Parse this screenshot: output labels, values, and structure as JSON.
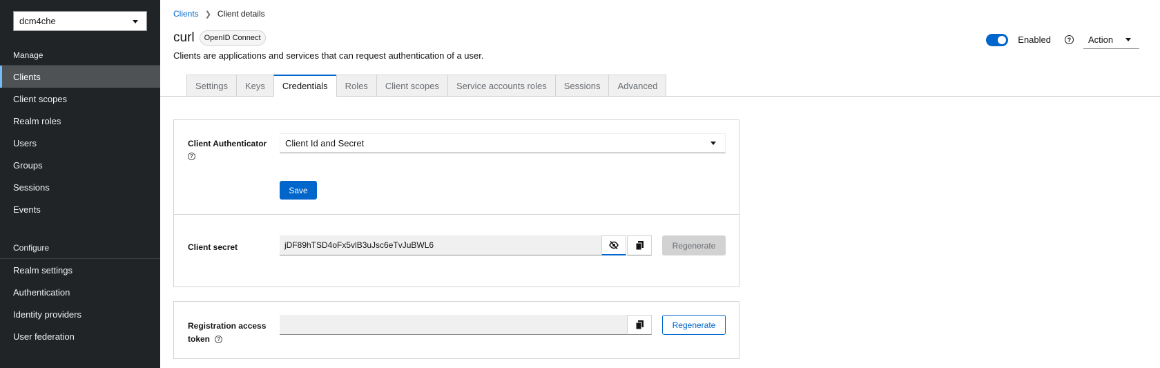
{
  "sidebar": {
    "realm_selector": "dcm4che",
    "manage_title": "Manage",
    "manage_items": [
      {
        "label": "Clients",
        "active": true
      },
      {
        "label": "Client scopes"
      },
      {
        "label": "Realm roles"
      },
      {
        "label": "Users"
      },
      {
        "label": "Groups"
      },
      {
        "label": "Sessions"
      },
      {
        "label": "Events"
      }
    ],
    "configure_title": "Configure",
    "configure_items": [
      {
        "label": "Realm settings"
      },
      {
        "label": "Authentication"
      },
      {
        "label": "Identity providers"
      },
      {
        "label": "User federation"
      }
    ]
  },
  "breadcrumb": {
    "parent": "Clients",
    "current": "Client details"
  },
  "header": {
    "title": "curl",
    "protocol_badge": "OpenID Connect",
    "description": "Clients are applications and services that can request authentication of a user.",
    "enabled_label": "Enabled",
    "enabled": true,
    "action_label": "Action"
  },
  "tabs": [
    {
      "label": "Settings"
    },
    {
      "label": "Keys"
    },
    {
      "label": "Credentials",
      "active": true
    },
    {
      "label": "Roles"
    },
    {
      "label": "Client scopes"
    },
    {
      "label": "Service accounts roles"
    },
    {
      "label": "Sessions"
    },
    {
      "label": "Advanced"
    }
  ],
  "credentials": {
    "authenticator_label": "Client Authenticator",
    "authenticator_value": "Client Id and Secret",
    "save_label": "Save",
    "secret_label": "Client secret",
    "secret_value": "jDF89hTSD4oFx5vlB3uJsc6eTvJuBWL6",
    "regenerate_label": "Regenerate",
    "registration_label_line1": "Registration access",
    "registration_label_line2": "token",
    "registration_value": "",
    "registration_regenerate_label": "Regenerate"
  },
  "colors": {
    "accent": "#0066cc",
    "sidebar_bg": "#212427",
    "active_nav_border": "#73bcf7"
  }
}
